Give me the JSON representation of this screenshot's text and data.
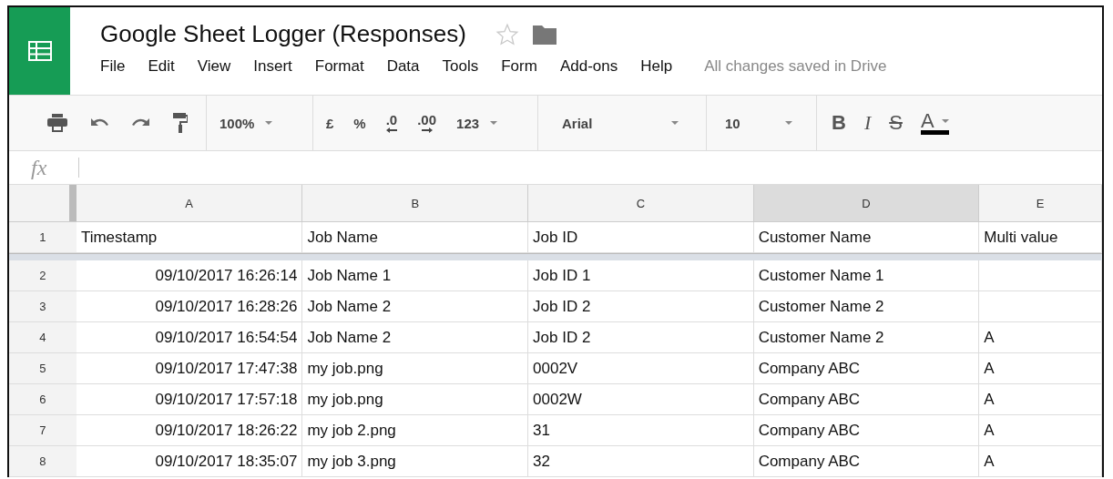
{
  "document": {
    "title": "Google Sheet Logger (Responses)",
    "starred": false
  },
  "menu": [
    {
      "label": "File"
    },
    {
      "label": "Edit"
    },
    {
      "label": "View"
    },
    {
      "label": "Insert"
    },
    {
      "label": "Format"
    },
    {
      "label": "Data"
    },
    {
      "label": "Tools"
    },
    {
      "label": "Form"
    },
    {
      "label": "Add-ons"
    },
    {
      "label": "Help"
    }
  ],
  "save_status": "All changes saved in Drive",
  "toolbar": {
    "zoom": "100%",
    "currency": "£",
    "percent": "%",
    "decrease_decimals": ".0",
    "increase_decimals": ".00",
    "number_format": "123",
    "font": "Arial",
    "font_size": "10",
    "bold": "B",
    "italic": "I",
    "strikethrough": "S",
    "text_color": "A"
  },
  "formula_bar": {
    "label": "fx"
  },
  "columns": [
    {
      "label": "A",
      "selected": false
    },
    {
      "label": "B",
      "selected": false
    },
    {
      "label": "C",
      "selected": false
    },
    {
      "label": "D",
      "selected": true
    },
    {
      "label": "E",
      "selected": false
    }
  ],
  "rows": [
    {
      "number": "1",
      "cells": [
        "Timestamp",
        "Job Name",
        "Job ID",
        "Customer Name",
        "Multi value"
      ]
    },
    {
      "number": "2",
      "cells": [
        "09/10/2017 16:26:14",
        "Job Name 1",
        "Job ID 1",
        "Customer Name 1",
        ""
      ]
    },
    {
      "number": "3",
      "cells": [
        "09/10/2017 16:28:26",
        "Job Name 2",
        "Job ID 2",
        "Customer Name 2",
        ""
      ]
    },
    {
      "number": "4",
      "cells": [
        "09/10/2017 16:54:54",
        "Job Name 2",
        "Job ID 2",
        "Customer Name 2",
        "A"
      ]
    },
    {
      "number": "5",
      "cells": [
        "09/10/2017 17:47:38",
        "my job.png",
        "0002V",
        "Company ABC",
        "A"
      ]
    },
    {
      "number": "6",
      "cells": [
        "09/10/2017 17:57:18",
        "my job.png",
        "0002W",
        "Company ABC",
        "A"
      ]
    },
    {
      "number": "7",
      "cells": [
        "09/10/2017 18:26:22",
        "my job 2.png",
        "31",
        "Company ABC",
        "A"
      ]
    },
    {
      "number": "8",
      "cells": [
        "09/10/2017 18:35:07",
        "my job 3.png",
        "32",
        "Company ABC",
        "A"
      ]
    }
  ]
}
